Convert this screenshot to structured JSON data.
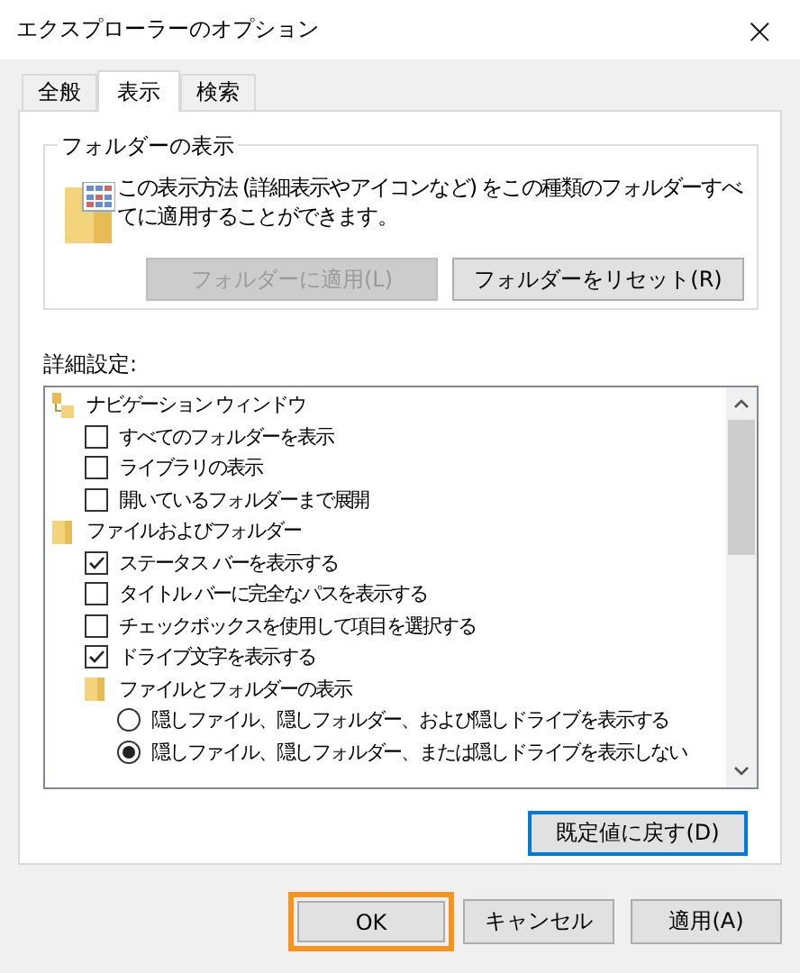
{
  "window": {
    "title": "エクスプローラーのオプション",
    "close": "×"
  },
  "tabs": [
    {
      "label": "全般",
      "selected": false
    },
    {
      "label": "表示",
      "selected": true
    },
    {
      "label": "検索",
      "selected": false
    }
  ],
  "folder_views": {
    "title": "フォルダーの表示",
    "description": "この表示方法 (詳細表示やアイコンなど) をこの種類のフォルダーすべてに適用することができます。",
    "buttons": [
      {
        "label": "フォルダーに適用(L)",
        "disabled": true
      },
      {
        "label": "フォルダーをリセット(R)",
        "disabled": false
      }
    ]
  },
  "advanced": {
    "label": "詳細設定:",
    "items": [
      {
        "kind": "group",
        "label": "ナビゲーション ウィンドウ",
        "children": [
          {
            "kind": "checkbox",
            "label": "すべてのフォルダーを表示",
            "checked": false
          },
          {
            "kind": "checkbox",
            "label": "ライブラリの表示",
            "checked": false
          },
          {
            "kind": "checkbox",
            "label": "開いているフォルダーまで展開",
            "checked": false
          }
        ]
      },
      {
        "kind": "group",
        "label": "ファイルおよびフォルダー",
        "children": [
          {
            "kind": "checkbox",
            "label": "ステータス バーを表示する",
            "checked": true
          },
          {
            "kind": "checkbox",
            "label": "タイトル バーに完全なパスを表示する",
            "checked": false
          },
          {
            "kind": "checkbox",
            "label": "チェックボックスを使用して項目を選択する",
            "checked": false
          },
          {
            "kind": "checkbox",
            "label": "ドライブ文字を表示する",
            "checked": true
          },
          {
            "kind": "group",
            "label": "ファイルとフォルダーの表示",
            "children": [
              {
                "kind": "radio",
                "label": "隠しファイル、隠しフォルダー、および隠しドライブを表示する",
                "selected": false
              },
              {
                "kind": "radio",
                "label": "隠しファイル、隠しフォルダー、または隠しドライブを表示しない",
                "selected": true
              }
            ]
          }
        ]
      }
    ],
    "restore_button": {
      "label": "既定値に戻す(D)",
      "focused": true
    }
  },
  "buttons": [
    {
      "label": "OK",
      "highlighted": true
    },
    {
      "label": "キャンセル",
      "highlighted": false
    },
    {
      "label": "適用(A)",
      "highlighted": false
    }
  ]
}
